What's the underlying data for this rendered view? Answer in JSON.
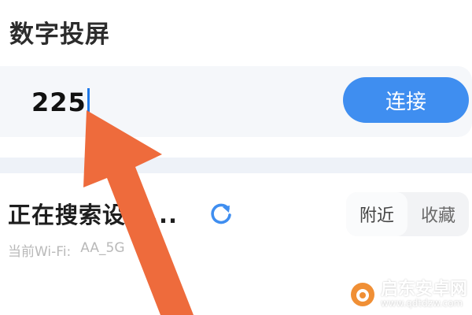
{
  "screen": {
    "title": "数字投屏"
  },
  "input": {
    "value": "225"
  },
  "connect_button": {
    "label": "连接"
  },
  "device_search": {
    "status_text": "正在搜索设备...",
    "tabs": [
      {
        "label": "附近",
        "active": true
      },
      {
        "label": "收藏",
        "active": false
      }
    ]
  },
  "wifi": {
    "label": "当前Wi-Fi:",
    "ssid": "AA_5G"
  },
  "watermark": {
    "title": "启东安卓网",
    "url": "www.qdtdzw.com"
  },
  "colors": {
    "accent": "#3f8ef0",
    "arrow": "#ee6b3c",
    "caret": "#1e78e8"
  },
  "icons": {
    "refresh": "refresh-icon",
    "arrow": "arrow-pointer-icon"
  }
}
